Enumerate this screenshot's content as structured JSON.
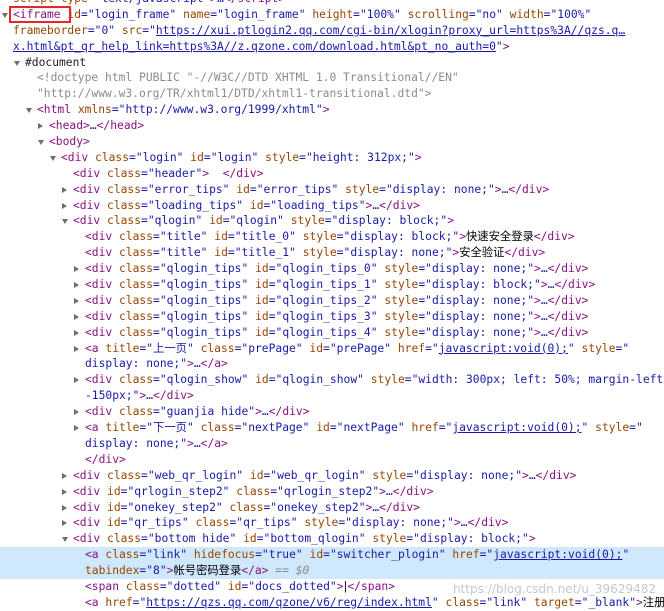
{
  "lines": [
    {
      "indent": 0,
      "tri": "",
      "html": "<span class=\"an\">script</span> <span class=\"an\">type</span>=\"<span class=\"av\">text/javascript</span>\"<span class=\"tag\">&gt;</span>…<span class=\"tag\">&lt;/script&gt;</span>"
    },
    {
      "indent": 0,
      "tri": "open",
      "html": "<span class=\"tag\">&lt;iframe</span> <span class=\"an\">id</span>=\"<span class=\"av\">login_frame</span>\" <span class=\"an\">name</span>=\"<span class=\"av\">login_frame</span>\" <span class=\"an\">height</span>=\"<span class=\"av\">100%</span>\" <span class=\"an\">scrolling</span>=\"<span class=\"av\">no</span>\" <span class=\"an\">width</span>=\"<span class=\"av\">100%</span>\""
    },
    {
      "indent": 0,
      "tri": "",
      "html": "<span class=\"an\">frameborder</span>=\"<span class=\"av\">0</span>\" <span class=\"an\">src</span>=\"<span class=\"lnk\">https://xui.ptlogin2.qq.com/cgi-bin/xlogin?proxy_url=https%3A//qzs.q…</span>"
    },
    {
      "indent": 0,
      "tri": "",
      "html": "<span class=\"lnk\">x.html&amp;pt_qr_help_link=https%3A//z.qzone.com/download.html&amp;pt_no_auth=0</span>\"<span class=\"tag\">&gt;</span>"
    },
    {
      "indent": 1,
      "tri": "open",
      "html": "<span class=\"doc\">#document</span>"
    },
    {
      "indent": 2,
      "tri": "",
      "html": "<span class=\"com\">&lt;!doctype html PUBLIC \"-//W3C//DTD XHTML 1.0 Transitional//EN\"</span>"
    },
    {
      "indent": 2,
      "tri": "",
      "html": "<span class=\"com\">\"http://www.w3.org/TR/xhtml1/DTD/xhtml1-transitional.dtd\"&gt;</span>"
    },
    {
      "indent": 2,
      "tri": "open",
      "html": "<span class=\"tag\">&lt;html</span> <span class=\"an\">xmlns</span>=\"<span class=\"av\">http://www.w3.org/1999/xhtml</span>\"<span class=\"tag\">&gt;</span>"
    },
    {
      "indent": 3,
      "tri": "closed",
      "html": "<span class=\"tag\">&lt;head&gt;</span>…<span class=\"tag\">&lt;/head&gt;</span>"
    },
    {
      "indent": 3,
      "tri": "open",
      "html": "<span class=\"tag\">&lt;body&gt;</span>"
    },
    {
      "indent": 4,
      "tri": "open",
      "html": "<span class=\"tag\">&lt;div</span> <span class=\"an\">class</span>=\"<span class=\"av\">login</span>\" <span class=\"an\">id</span>=\"<span class=\"av\">login</span>\" <span class=\"an\">style</span>=\"<span class=\"av\">height: 312px;</span>\"<span class=\"tag\">&gt;</span>"
    },
    {
      "indent": 5,
      "tri": "",
      "html": "<span class=\"tag\">&lt;div</span> <span class=\"an\">class</span>=\"<span class=\"av\">header</span>\"<span class=\"tag\">&gt;</span>  <span class=\"tag\">&lt;/div&gt;</span>"
    },
    {
      "indent": 5,
      "tri": "closed",
      "html": "<span class=\"tag\">&lt;div</span> <span class=\"an\">class</span>=\"<span class=\"av\">error_tips</span>\" <span class=\"an\">id</span>=\"<span class=\"av\">error_tips</span>\" <span class=\"an\">style</span>=\"<span class=\"av\">display: none;</span>\"<span class=\"tag\">&gt;</span>…<span class=\"tag\">&lt;/div&gt;</span>"
    },
    {
      "indent": 5,
      "tri": "closed",
      "html": "<span class=\"tag\">&lt;div</span> <span class=\"an\">class</span>=\"<span class=\"av\">loading_tips</span>\" <span class=\"an\">id</span>=\"<span class=\"av\">loading_tips</span>\"<span class=\"tag\">&gt;</span>…<span class=\"tag\">&lt;/div&gt;</span>"
    },
    {
      "indent": 5,
      "tri": "open",
      "html": "<span class=\"tag\">&lt;div</span> <span class=\"an\">class</span>=\"<span class=\"av\">qlogin</span>\" <span class=\"an\">id</span>=\"<span class=\"av\">qlogin</span>\" <span class=\"an\">style</span>=\"<span class=\"av\">display: block;</span>\"<span class=\"tag\">&gt;</span>"
    },
    {
      "indent": 6,
      "tri": "",
      "html": "<span class=\"tag\">&lt;div</span> <span class=\"an\">class</span>=\"<span class=\"av\">title</span>\" <span class=\"an\">id</span>=\"<span class=\"av\">title_0</span>\" <span class=\"an\">style</span>=\"<span class=\"av\">display: block;</span>\"<span class=\"tag\">&gt;</span><span class=\"txtnode\">快速安全登录</span><span class=\"tag\">&lt;/div&gt;</span>"
    },
    {
      "indent": 6,
      "tri": "",
      "html": "<span class=\"tag\">&lt;div</span> <span class=\"an\">class</span>=\"<span class=\"av\">title</span>\" <span class=\"an\">id</span>=\"<span class=\"av\">title_1</span>\" <span class=\"an\">style</span>=\"<span class=\"av\">display: none;</span>\"<span class=\"tag\">&gt;</span><span class=\"txtnode\">安全验证</span><span class=\"tag\">&lt;/div&gt;</span>"
    },
    {
      "indent": 6,
      "tri": "closed",
      "html": "<span class=\"tag\">&lt;div</span> <span class=\"an\">class</span>=\"<span class=\"av\">qlogin_tips</span>\" <span class=\"an\">id</span>=\"<span class=\"av\">qlogin_tips_0</span>\" <span class=\"an\">style</span>=\"<span class=\"av\">display: none;</span>\"<span class=\"tag\">&gt;</span>…<span class=\"tag\">&lt;/div&gt;</span>"
    },
    {
      "indent": 6,
      "tri": "closed",
      "html": "<span class=\"tag\">&lt;div</span> <span class=\"an\">class</span>=\"<span class=\"av\">qlogin_tips</span>\" <span class=\"an\">id</span>=\"<span class=\"av\">qlogin_tips_1</span>\" <span class=\"an\">style</span>=\"<span class=\"av\">display: block;</span>\"<span class=\"tag\">&gt;</span>…<span class=\"tag\">&lt;/div&gt;</span>"
    },
    {
      "indent": 6,
      "tri": "closed",
      "html": "<span class=\"tag\">&lt;div</span> <span class=\"an\">class</span>=\"<span class=\"av\">qlogin_tips</span>\" <span class=\"an\">id</span>=\"<span class=\"av\">qlogin_tips_2</span>\" <span class=\"an\">style</span>=\"<span class=\"av\">display: none;</span>\"<span class=\"tag\">&gt;</span>…<span class=\"tag\">&lt;/div&gt;</span>"
    },
    {
      "indent": 6,
      "tri": "closed",
      "html": "<span class=\"tag\">&lt;div</span> <span class=\"an\">class</span>=\"<span class=\"av\">qlogin_tips</span>\" <span class=\"an\">id</span>=\"<span class=\"av\">qlogin_tips_3</span>\" <span class=\"an\">style</span>=\"<span class=\"av\">display: none;</span>\"<span class=\"tag\">&gt;</span>…<span class=\"tag\">&lt;/div&gt;</span>"
    },
    {
      "indent": 6,
      "tri": "closed",
      "html": "<span class=\"tag\">&lt;div</span> <span class=\"an\">class</span>=\"<span class=\"av\">qlogin_tips</span>\" <span class=\"an\">id</span>=\"<span class=\"av\">qlogin_tips_4</span>\" <span class=\"an\">style</span>=\"<span class=\"av\">display: none;</span>\"<span class=\"tag\">&gt;</span>…<span class=\"tag\">&lt;/div&gt;</span>"
    },
    {
      "indent": 6,
      "tri": "closed",
      "html": "<span class=\"tag\">&lt;a</span> <span class=\"an\">title</span>=\"<span class=\"av\">上一页</span>\" <span class=\"an\">class</span>=\"<span class=\"av\">prePage</span>\" <span class=\"an\">id</span>=\"<span class=\"av\">prePage</span>\" <span class=\"an\">href</span>=\"<span class=\"lnk\">javascript:void(0);</span>\" <span class=\"an\">style</span>=\""
    },
    {
      "indent": 6,
      "tri": "",
      "html": "<span class=\"av\">display: none;</span>\"<span class=\"tag\">&gt;</span>…<span class=\"tag\">&lt;/a&gt;</span>"
    },
    {
      "indent": 6,
      "tri": "closed",
      "html": "<span class=\"tag\">&lt;div</span> <span class=\"an\">class</span>=\"<span class=\"av\">qlogin_show</span>\" <span class=\"an\">id</span>=\"<span class=\"av\">qlogin_show</span>\" <span class=\"an\">style</span>=\"<span class=\"av\">width: 300px; left: 50%; margin-left:</span>"
    },
    {
      "indent": 6,
      "tri": "",
      "html": "<span class=\"av\">-150px;</span>\"<span class=\"tag\">&gt;</span>…<span class=\"tag\">&lt;/div&gt;</span>"
    },
    {
      "indent": 6,
      "tri": "closed",
      "html": "<span class=\"tag\">&lt;div</span> <span class=\"an\">class</span>=\"<span class=\"av\">guanjia hide</span>\"<span class=\"tag\">&gt;</span>…<span class=\"tag\">&lt;/div&gt;</span>"
    },
    {
      "indent": 6,
      "tri": "closed",
      "html": "<span class=\"tag\">&lt;a</span> <span class=\"an\">title</span>=\"<span class=\"av\">下一页</span>\" <span class=\"an\">class</span>=\"<span class=\"av\">nextPage</span>\" <span class=\"an\">id</span>=\"<span class=\"av\">nextPage</span>\" <span class=\"an\">href</span>=\"<span class=\"lnk\">javascript:void(0);</span>\" <span class=\"an\">style</span>=\""
    },
    {
      "indent": 6,
      "tri": "",
      "html": "<span class=\"av\">display: none;</span>\"<span class=\"tag\">&gt;</span>…<span class=\"tag\">&lt;/a&gt;</span>"
    },
    {
      "indent": 6,
      "tri": "",
      "html": "<span class=\"tag\">&lt;/div&gt;</span>"
    },
    {
      "indent": 5,
      "tri": "closed",
      "html": "<span class=\"tag\">&lt;div</span> <span class=\"an\">class</span>=\"<span class=\"av\">web_qr_login</span>\" <span class=\"an\">id</span>=\"<span class=\"av\">web_qr_login</span>\" <span class=\"an\">style</span>=\"<span class=\"av\">display: none;</span>\"<span class=\"tag\">&gt;</span>…<span class=\"tag\">&lt;/div&gt;</span>"
    },
    {
      "indent": 5,
      "tri": "closed",
      "html": "<span class=\"tag\">&lt;div</span> <span class=\"an\">id</span>=\"<span class=\"av\">qrlogin_step2</span>\" <span class=\"an\">class</span>=\"<span class=\"av\">qrlogin_step2</span>\"<span class=\"tag\">&gt;</span>…<span class=\"tag\">&lt;/div&gt;</span>"
    },
    {
      "indent": 5,
      "tri": "closed",
      "html": "<span class=\"tag\">&lt;div</span> <span class=\"an\">id</span>=\"<span class=\"av\">onekey_step2</span>\" <span class=\"an\">class</span>=\"<span class=\"av\">onekey_step2</span>\"<span class=\"tag\">&gt;</span>…<span class=\"tag\">&lt;/div&gt;</span>"
    },
    {
      "indent": 5,
      "tri": "closed",
      "html": "<span class=\"tag\">&lt;div</span> <span class=\"an\">id</span>=\"<span class=\"av\">qr_tips</span>\" <span class=\"an\">class</span>=\"<span class=\"av\">qr_tips</span>\" <span class=\"an\">style</span>=\"<span class=\"av\">display: none;</span>\"<span class=\"tag\">&gt;</span>…<span class=\"tag\">&lt;/div&gt;</span>"
    },
    {
      "indent": 5,
      "tri": "open",
      "html": "<span class=\"tag\">&lt;div</span> <span class=\"an\">class</span>=\"<span class=\"av\">bottom hide</span>\" <span class=\"an\">id</span>=\"<span class=\"av\">bottom_qlogin</span>\" <span class=\"an\">style</span>=\"<span class=\"av\">display: block;</span>\"<span class=\"tag\">&gt;</span>"
    },
    {
      "indent": 6,
      "tri": "",
      "sel": true,
      "html": "<span class=\"tag\">&lt;a</span> <span class=\"an\">class</span>=\"<span class=\"av\">link</span>\" <span class=\"an\">hidefocus</span>=\"<span class=\"av\">true</span>\" <span class=\"an\">id</span>=\"<span class=\"av\">switcher_plogin</span>\" <span class=\"an\">href</span>=\"<span class=\"lnk\">javascript:void(0);</span>\""
    },
    {
      "indent": 6,
      "tri": "",
      "sel": true,
      "html": "<span class=\"an\">tabindex</span>=\"<span class=\"av\">8</span>\"<span class=\"tag\">&gt;</span><span class=\"txtnode\">帐号密码登录</span><span class=\"tag\">&lt;/a&gt;</span> <span class=\"eq\">==</span> <span class=\"dv\">$0</span>"
    },
    {
      "indent": 6,
      "tri": "",
      "html": "<span class=\"tag\">&lt;span</span> <span class=\"an\">class</span>=\"<span class=\"av\">dotted</span>\" <span class=\"an\">id</span>=\"<span class=\"av\">docs_dotted</span>\"<span class=\"tag\">&gt;</span><span class=\"txtnode\">|</span><span class=\"tag\">&lt;/span&gt;</span>"
    },
    {
      "indent": 6,
      "tri": "",
      "html": "<span class=\"tag\">&lt;a</span> <span class=\"an\">href</span>=\"<span class=\"lnk\">https://qzs.qq.com/qzone/v6/reg/index.html</span>\" <span class=\"an\">class</span>=\"<span class=\"av\">link</span>\" <span class=\"an\">target</span>=\"<span class=\"av\">_blank</span>\"<span class=\"tag\">&gt;</span><span class=\"txtnode\">注册</span>"
    }
  ],
  "watermark": "https://blog.csdn.net/u_39629482"
}
